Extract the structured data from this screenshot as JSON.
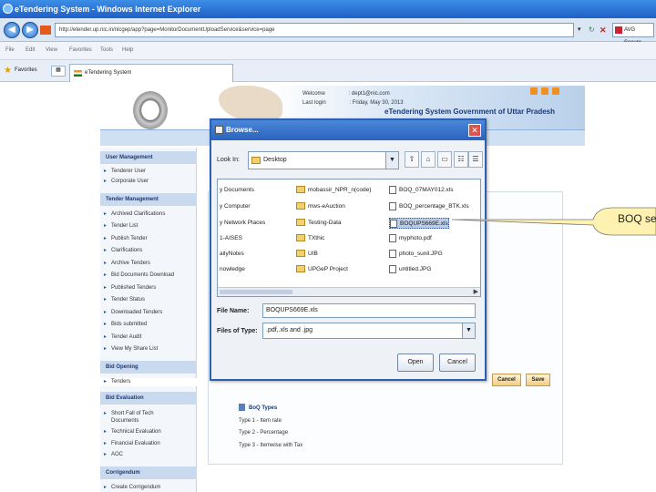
{
  "browser": {
    "title": "eTendering System - Windows Internet Explorer",
    "url": "http://etender.up.nic.in/nicgep/app?page=MonitorDocumentUploadService&service=page",
    "menu": [
      "File",
      "Edit",
      "View",
      "Favorites",
      "Tools",
      "Help"
    ],
    "favorites_label": "Favorites",
    "tab_label": "eTendering System",
    "search_label": "AVG Secure"
  },
  "site": {
    "welcome_label": "Welcome",
    "welcome_value": ": dept1@nic.com",
    "last_login_label": "Last login",
    "last_login_value": ": Friday, May 30, 2013",
    "title": "eTendering System Government of Uttar Pradesh",
    "sidebar": [
      {
        "section": "User Management",
        "items": [
          "Tenderer User",
          "Corporate User"
        ]
      },
      {
        "section": "Tender Management",
        "items": [
          "Archived Clarifications",
          "Tender List",
          "Publish Tender",
          "Clarifications",
          "Archive Tenders",
          "Bid Documents Download",
          "Published Tenders",
          "Tender Status",
          "Downloaded Tenders",
          "Bids submitted",
          "Tender Audit",
          "View My Share List"
        ]
      },
      {
        "section": "Bid Opening",
        "items": [
          "Tenders"
        ]
      },
      {
        "section": "Bid Evaluation",
        "items": [
          "Short Fall of Tech Documents",
          "Technical Evaluation",
          "Financial Evaluation",
          "AOC"
        ]
      },
      {
        "section": "Corrigendum",
        "items": [
          "Create Corrigendum"
        ]
      }
    ],
    "cancel_label": "Cancel",
    "save_label": "Save",
    "boq_types": {
      "heading": "BoQ Types",
      "items": [
        "Type 1 - Item rate",
        "Type 2 - Percentage",
        "Type 3 - Itemwise with Tax"
      ]
    }
  },
  "dialog": {
    "title": "Browse...",
    "look_in_label": "Look In:",
    "look_in_value": "Desktop",
    "files": [
      {
        "name": "y Documents",
        "kind": "partial"
      },
      {
        "name": "y Computer",
        "kind": "partial"
      },
      {
        "name": "y Network Places",
        "kind": "partial"
      },
      {
        "name": "1-AISES",
        "kind": "partial"
      },
      {
        "name": "ailyNotes",
        "kind": "partial"
      },
      {
        "name": "nowledge",
        "kind": "partial"
      },
      {
        "name": "mobassir_NPR_n(code)",
        "kind": "folder"
      },
      {
        "name": "mws-eAuction",
        "kind": "folder"
      },
      {
        "name": "Testing-Data",
        "kind": "folder"
      },
      {
        "name": "TXthic",
        "kind": "folder"
      },
      {
        "name": "UIB",
        "kind": "folder"
      },
      {
        "name": "UPGeP Project",
        "kind": "folder"
      },
      {
        "name": "BOQ_07MAY012.xls",
        "kind": "file"
      },
      {
        "name": "BOQ_percentage_BTK.xls",
        "kind": "file"
      },
      {
        "name": "BOQUPS669E.xls",
        "kind": "file",
        "selected": true
      },
      {
        "name": "myphoto.pdf",
        "kind": "file"
      },
      {
        "name": "photo_sunil.JPG",
        "kind": "file"
      },
      {
        "name": "untitled.JPG",
        "kind": "file"
      }
    ],
    "file_name_label": "File Name:",
    "file_name_value": "BOQUPS669E.xls",
    "files_of_type_label": "Files of Type:",
    "files_of_type_value": ".pdf,.xls and .jpg",
    "open_label": "Open",
    "cancel_label": "Cancel"
  },
  "callout": {
    "text": "BOQ sele"
  },
  "colors": {
    "titlebar": "#2a63bd",
    "sidebar_section": "#c9d9ee",
    "callout_fill": "#fff1b0"
  }
}
